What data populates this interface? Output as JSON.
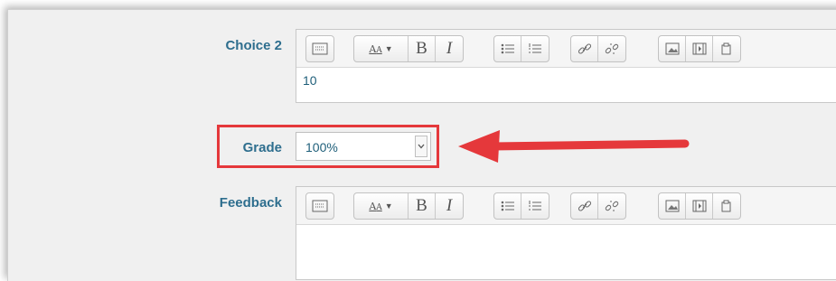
{
  "fields": {
    "choice": {
      "label": "Choice 2",
      "value": "10"
    },
    "grade": {
      "label": "Grade",
      "selected": "100%"
    },
    "feedback": {
      "label": "Feedback",
      "value": ""
    }
  },
  "toolbar": {
    "groups": [
      [
        "toolbar-toggle-icon"
      ],
      [
        "font-style-icon",
        "bold-icon",
        "italic-icon"
      ],
      [
        "unordered-list-icon",
        "ordered-list-icon"
      ],
      [
        "link-icon",
        "unlink-icon"
      ],
      [
        "image-icon",
        "media-icon",
        "manage-files-icon"
      ]
    ],
    "bold_glyph": "B",
    "italic_glyph": "I"
  },
  "annotation": {
    "highlight_color": "#e5383b",
    "arrow_color": "#e5383b"
  },
  "colors": {
    "label": "#2e6e8e",
    "value_text": "#1f5f7a",
    "form_bg": "#f0f0f0"
  }
}
